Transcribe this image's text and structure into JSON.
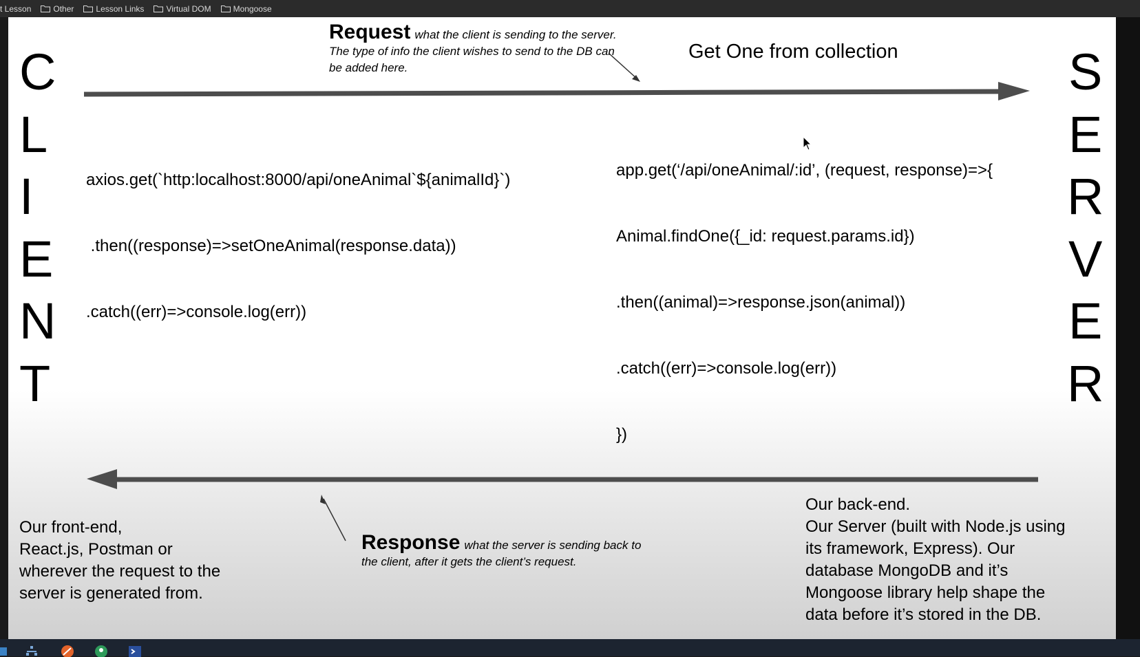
{
  "bookmarks": [
    {
      "label": "ct Lesson",
      "has_folder": false
    },
    {
      "label": "Other",
      "has_folder": true
    },
    {
      "label": "Lesson Links",
      "has_folder": true
    },
    {
      "label": "Virtual DOM",
      "has_folder": true
    },
    {
      "label": "Mongoose",
      "has_folder": true
    }
  ],
  "slide": {
    "client_letters": [
      "C",
      "L",
      "I",
      "E",
      "N",
      "T"
    ],
    "server_letters": [
      "S",
      "E",
      "R",
      "V",
      "E",
      "R"
    ],
    "request": {
      "title": "Request",
      "text": "what the client is sending to the server. The type of info the client wishes to send to the DB can be added here."
    },
    "response": {
      "title": "Response",
      "text": "what the server is sending back to the client, after it gets the client’s request."
    },
    "get_one_title": "Get One from collection",
    "client_code": [
      "axios.get(`http:localhost:8000/api/oneAnimal`${animalId}`)",
      " .then((response)=>setOneAnimal(response.data))",
      ".catch((err)=>console.log(err))"
    ],
    "server_code": [
      "app.get(‘/api/oneAnimal/:id’, (request, response)=>{",
      "Animal.findOne({_id: request.params.id})",
      ".then((animal)=>response.json(animal))",
      ".catch((err)=>console.log(err))",
      "})"
    ],
    "client_desc": [
      "Our front-end,",
      "React.js, Postman or",
      "wherever the request to the",
      "server is generated from."
    ],
    "server_desc": [
      "Our back-end.",
      "Our Server (built with Node.js using",
      "its framework, Express). Our",
      "database MongoDB and it’s",
      "Mongoose library help shape the",
      "data before it’s stored in the DB."
    ]
  },
  "taskbar_icons": [
    "file-explorer-icon",
    "network-icon",
    "browser-icon",
    "maps-icon",
    "terminal-icon"
  ],
  "colors": {
    "arrow": "#4d4d4d",
    "bookmarks_bg": "#2b2b2b",
    "taskbar_bg": "#1c2430"
  }
}
